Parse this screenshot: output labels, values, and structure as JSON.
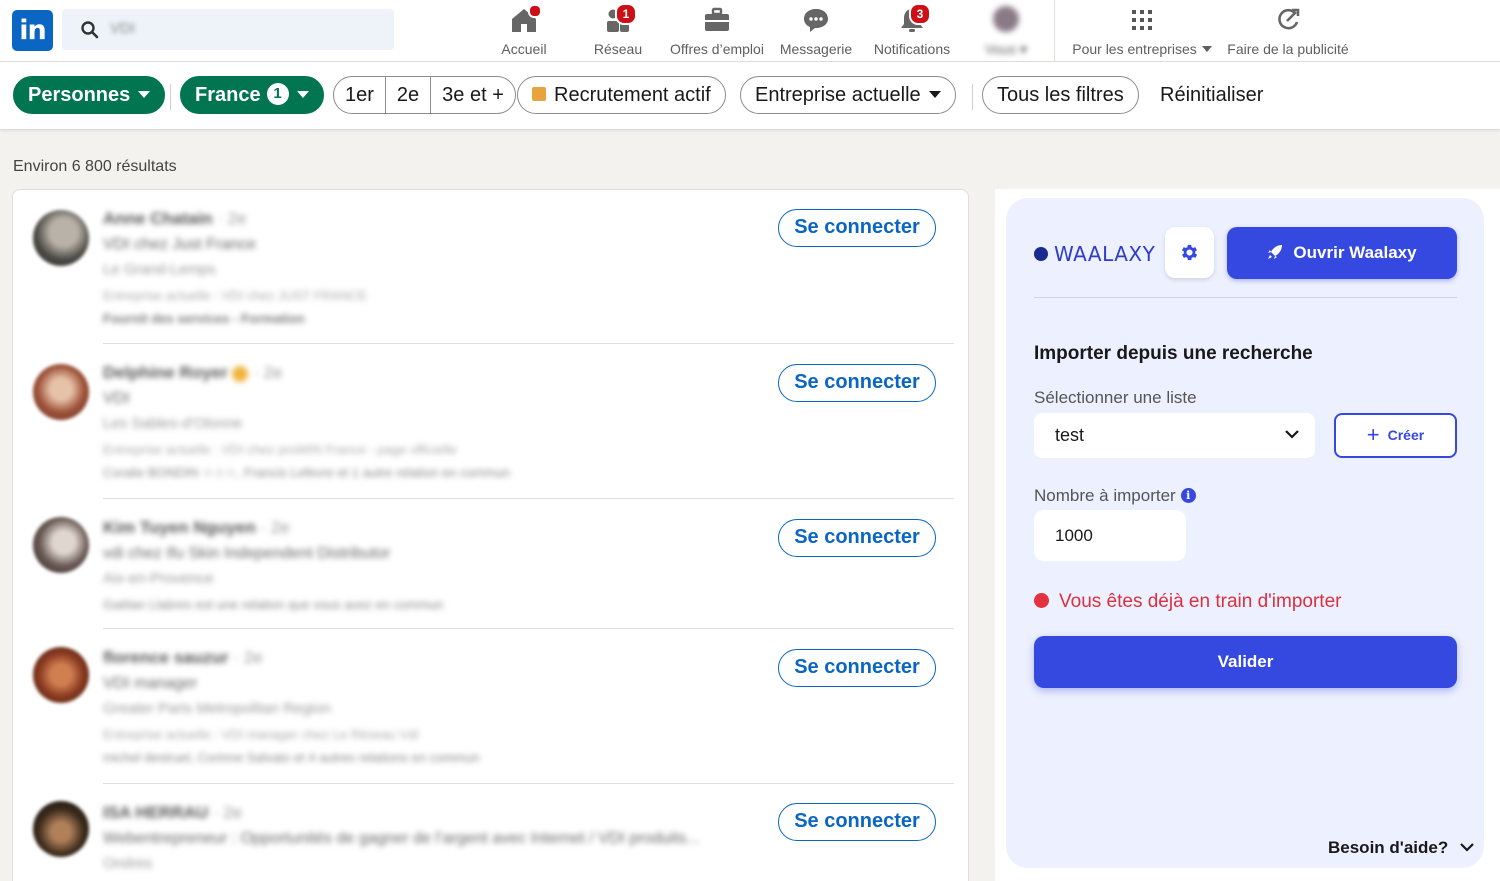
{
  "nav": {
    "logo": "in",
    "search_value": "VDI",
    "items": [
      {
        "label": "Accueil",
        "badge": ""
      },
      {
        "label": "Réseau",
        "badge": "1"
      },
      {
        "label": "Offres d’emploi",
        "badge": ""
      },
      {
        "label": "Messagerie",
        "badge": ""
      },
      {
        "label": "Notifications",
        "badge": "3"
      },
      {
        "label": "Vous ▾",
        "badge": ""
      }
    ],
    "business": "Pour les entreprises",
    "advertise": "Faire de la publicité"
  },
  "filters": {
    "people": "Personnes",
    "location": "France",
    "location_count": "1",
    "degree": [
      "1er",
      "2e",
      "3e et +"
    ],
    "actively_hiring": "Recrutement actif",
    "current_company": "Entreprise actuelle",
    "all_filters": "Tous les filtres",
    "reset": "Réinitialiser"
  },
  "results": {
    "count_text": "Environ 6 800 résultats",
    "connect_label": "Se connecter",
    "rows": [
      {
        "name": "Anne Chatain",
        "degree": "· 2e",
        "headline": "VDI chez Just France",
        "location": "Le Grand-Lemps",
        "extra1": "Entreprise actuelle : VDI chez JUST FRANCE",
        "extra2": "Fournit des services - Formation"
      },
      {
        "name": "Delphine Royer",
        "degree": "· 2e",
        "headline": "VDI",
        "location": "Les Sables-d’Olonne",
        "extra1": "Entreprise actuelle : VDI chez proWIN France - page officielle",
        "extra2": "Coralie BONDIN ☆☆☆, Francis Lefevre et 1 autre relation en commun"
      },
      {
        "name": "Kim Tuyen Nguyen",
        "degree": "· 2e",
        "headline": "vdi chez Ifu Skin Independent Distributor",
        "location": "Aix-en-Provence",
        "extra1": "Gaëtan Llabres est une relation que vous avez en commun",
        "extra2": ""
      },
      {
        "name": "florence sauzur",
        "degree": "· 2e",
        "headline": "VDI manager",
        "location": "Greater Paris Metropolitan Region",
        "extra1": "Entreprise actuelle : VDI manager chez Le Réseau VdI",
        "extra2": "michel destruel, Corinne Salvato et 4 autres relations en commun"
      },
      {
        "name": "ISA HERRAU",
        "degree": "· 2e",
        "headline": "Webentrepreneur : Opportunités de gagner de l’argent avec Internet / VDI produits...",
        "location": "Ondres",
        "extra1": "",
        "extra2": ""
      }
    ]
  },
  "waalaxy": {
    "brand": "WAALAXY",
    "open_button": "Ouvrir Waalaxy",
    "title": "Importer depuis une recherche",
    "select_list_label": "Sélectionner une liste",
    "selected_list": "test",
    "create_button": "Créer",
    "number_label": "Nombre à importer",
    "number_value": "1000",
    "error_text": "Vous êtes déjà en train d'importer",
    "submit_button": "Valider",
    "help": "Besoin d'aide?"
  },
  "colors": {
    "linkedin_blue": "#0a66c2",
    "filter_green": "#01754f",
    "waalaxy_blue": "#3548e0",
    "error_red": "#d93140"
  }
}
